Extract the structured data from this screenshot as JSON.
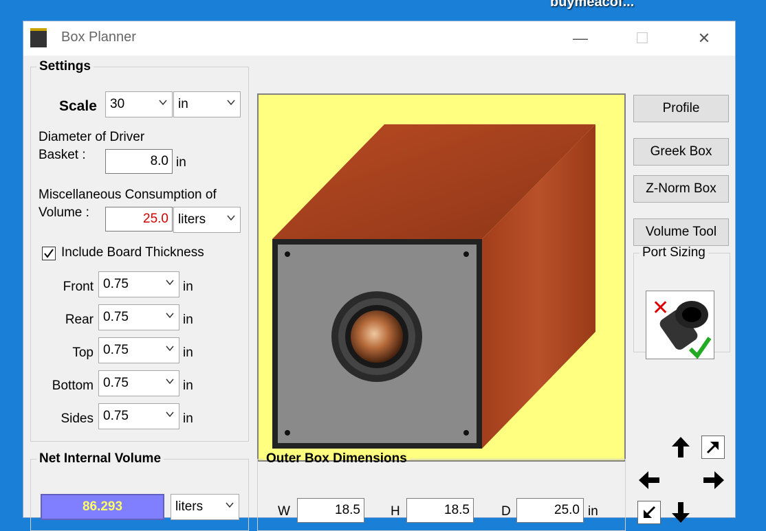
{
  "desktop": {
    "label": "buymeacof..."
  },
  "window": {
    "title": "Box Planner",
    "minimize": "—",
    "maximize": "☐",
    "close": "✕"
  },
  "settings": {
    "legend": "Settings",
    "scale_label": "Scale",
    "scale_value": "30",
    "scale_unit": "in",
    "diameter_label_1": "Diameter of Driver",
    "diameter_label_2": "Basket :",
    "diameter_value": "8.0",
    "diameter_unit": "in",
    "misc_label_1": "Miscellaneous Consumption of",
    "misc_label_2": "Volume :",
    "misc_value": "25.0",
    "misc_unit": "liters",
    "include_board_label": "Include Board Thickness",
    "include_board_checked": true,
    "board": [
      {
        "label": "Front",
        "value": "0.75",
        "unit": "in"
      },
      {
        "label": "Rear",
        "value": "0.75",
        "unit": "in"
      },
      {
        "label": "Top",
        "value": "0.75",
        "unit": "in"
      },
      {
        "label": "Bottom",
        "value": "0.75",
        "unit": "in"
      },
      {
        "label": "Sides",
        "value": "0.75",
        "unit": "in"
      }
    ]
  },
  "net_volume": {
    "legend": "Net Internal Volume",
    "value": "86.293",
    "unit": "liters"
  },
  "outer": {
    "legend": "Outer Box Dimensions",
    "w_label": "W",
    "w_value": "18.5",
    "h_label": "H",
    "h_value": "18.5",
    "d_label": "D",
    "d_value": "25.0",
    "unit": "in"
  },
  "buttons": {
    "profile": "Profile",
    "greek": "Greek Box",
    "znorm": "Z-Norm Box",
    "volume_tool": "Volume Tool"
  },
  "port": {
    "legend": "Port Sizing"
  },
  "colors": {
    "preview_bg": "#ffff80",
    "wood": "#a8421f",
    "net_bg": "#7f7fff",
    "misc_text": "#cc0000"
  }
}
